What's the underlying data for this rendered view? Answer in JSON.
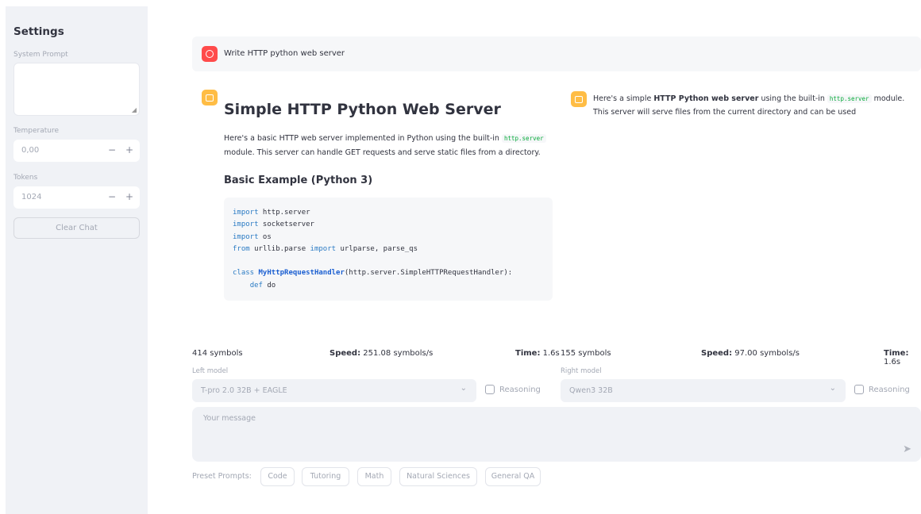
{
  "sidebar": {
    "title": "Settings",
    "system_prompt_label": "System Prompt",
    "system_prompt_value": "",
    "temperature_label": "Temperature",
    "temperature_value": "0,00",
    "tokens_label": "Tokens",
    "tokens_value": "1024",
    "stepper_minus": "−",
    "stepper_plus": "+",
    "clear_button": "Clear Chat"
  },
  "chat": {
    "user_message": "Write HTTP python web server",
    "left_response": {
      "heading": "Simple HTTP Python Web Server",
      "para_before": "Here's a basic HTTP web server implemented in Python using the built-in ",
      "para_code": "http.server",
      "para_after": " module. This server can handle GET requests and serve static files from a directory.",
      "subheading": "Basic Example (Python 3)",
      "code_lines": [
        [
          {
            "t": "import",
            "c": "kw"
          },
          {
            "t": " http.server"
          }
        ],
        [
          {
            "t": "import",
            "c": "kw"
          },
          {
            "t": " socketserver"
          }
        ],
        [
          {
            "t": "import",
            "c": "kw"
          },
          {
            "t": " os"
          }
        ],
        [
          {
            "t": "from",
            "c": "kw"
          },
          {
            "t": " urllib.parse "
          },
          {
            "t": "import",
            "c": "kw"
          },
          {
            "t": " urlparse, parse_qs"
          }
        ],
        [],
        [
          {
            "t": "class",
            "c": "kw"
          },
          {
            "t": " "
          },
          {
            "t": "MyHttpRequestHandler",
            "c": "cls"
          },
          {
            "t": "(http.server.SimpleHTTPRequestHandler):"
          }
        ],
        [
          {
            "t": "    "
          },
          {
            "t": "def",
            "c": "kw"
          },
          {
            "t": " do"
          }
        ]
      ]
    },
    "right_response": {
      "part1": "Here's a simple ",
      "bold": "HTTP Python web server",
      "part2": " using the built-in ",
      "code": "http.server",
      "part3": " module. This server will serve files from the current directory and can be used"
    }
  },
  "stats": {
    "left": {
      "symbols": "414 symbols",
      "speed_label": "Speed:",
      "speed_value": " 251.08 symbols/s",
      "time_label": "Time:",
      "time_value": " 1.6s"
    },
    "right": {
      "symbols": "155 symbols",
      "speed_label": "Speed:",
      "speed_value": " 97.00 symbols/s",
      "time_label": "Time:",
      "time_value": " 1.6s"
    }
  },
  "models": {
    "left_label": "Left model",
    "left_value": "T-pro 2.0 32B + EAGLE",
    "right_label": "Right model",
    "right_value": "Qwen3 32B",
    "reasoning_label": "Reasoning"
  },
  "input": {
    "placeholder": "Your message"
  },
  "presets": {
    "label": "Preset Prompts:",
    "items": [
      "Code",
      "Tutoring",
      "Math",
      "Natural Sciences",
      "General QA"
    ]
  }
}
